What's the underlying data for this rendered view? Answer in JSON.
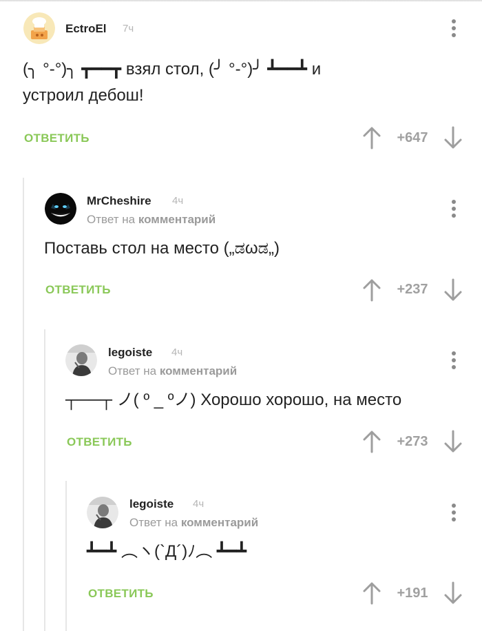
{
  "comments": [
    {
      "username": "EctroEl",
      "time": "7ч",
      "text": "(╮ °-°)╮ ┳━━┳ взял стол, (╯ °-°)╯ ┻━━┻ и\nустроил дебош!",
      "reply_label": "ОТВЕТИТЬ",
      "rating": "+647"
    },
    {
      "username": "MrCheshire",
      "time": "4ч",
      "reply_prefix": "Ответ на",
      "reply_target": "комментарий",
      "text": "Поставь стол на место („ಡωಡ„)",
      "reply_label": "ОТВЕТИТЬ",
      "rating": "+237"
    },
    {
      "username": "legoiste",
      "time": "4ч",
      "reply_prefix": "Ответ на",
      "reply_target": "комментарий",
      "text": "┬──┬ ノ( º _ ºノ) Хорошо хорошо, на место",
      "reply_label": "ОТВЕТИТЬ",
      "rating": "+273"
    },
    {
      "username": "legoiste",
      "time": "4ч",
      "reply_prefix": "Ответ на",
      "reply_target": "комментарий",
      "text": "┻━┻ ︵ヽ(`Д´)ﾉ︵ ┻━┻",
      "reply_label": "ОТВЕТИТЬ",
      "rating": "+191"
    }
  ],
  "icons": {
    "menu": "more-vertical-icon",
    "upvote": "arrow-up-icon",
    "downvote": "arrow-down-icon"
  },
  "colors": {
    "accent_green": "#8ac858",
    "muted_gray": "#9a9a9a",
    "thread_line": "#e6e6e6"
  }
}
